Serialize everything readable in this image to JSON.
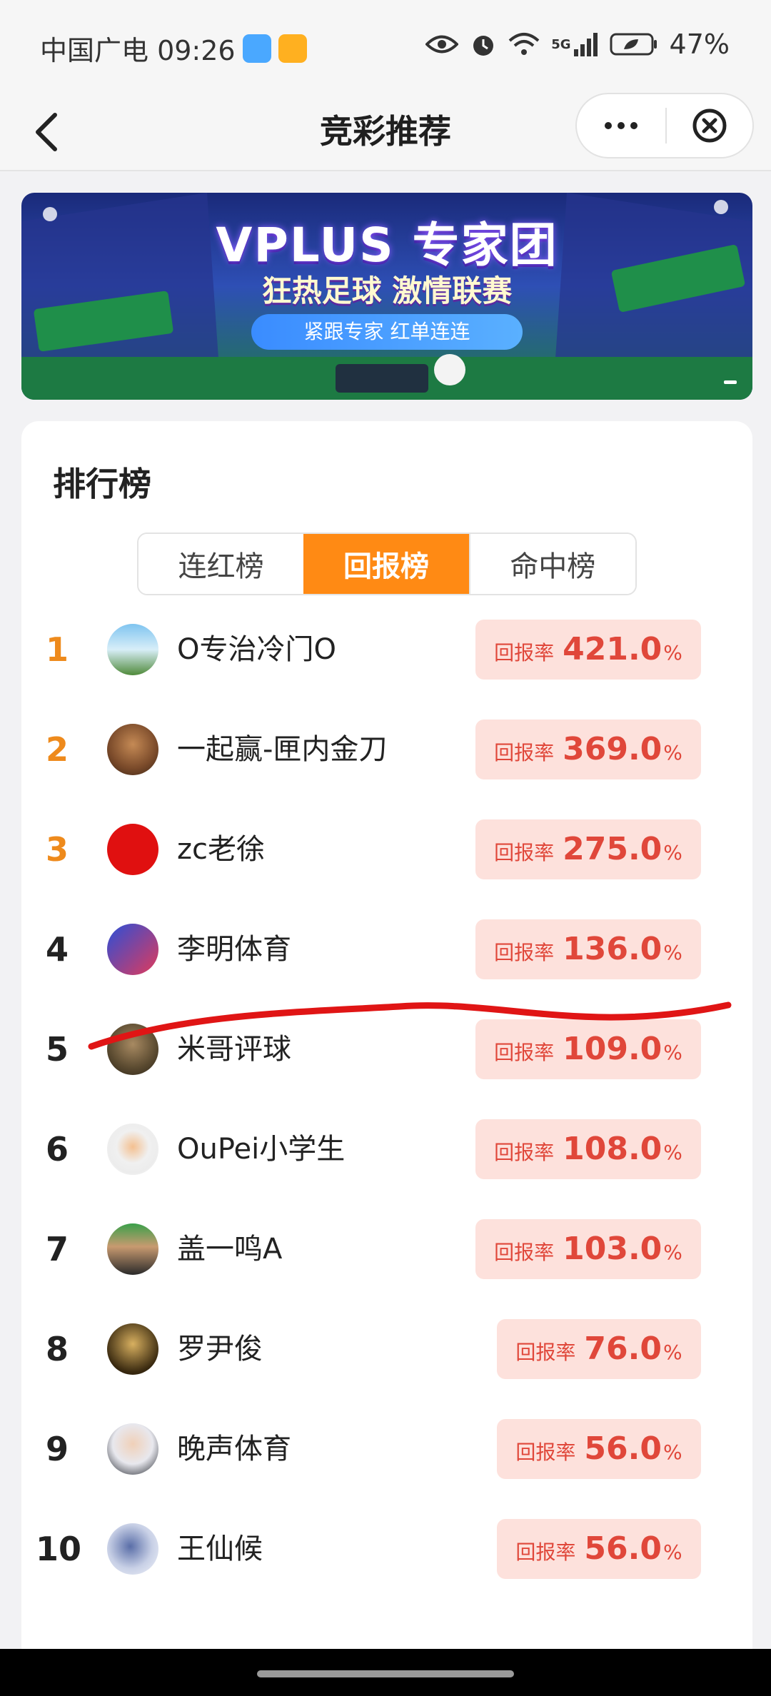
{
  "status_bar": {
    "carrier_time": "中国广电 09:26",
    "network": "5G",
    "battery": "47%",
    "icons": [
      "weather-icon",
      "weibo-icon",
      "eye-icon",
      "alarm-icon",
      "wifi-icon",
      "signal-icon",
      "battery-icon"
    ]
  },
  "header": {
    "title": "竞彩推荐",
    "icons": [
      "back-icon",
      "more-icon",
      "close-icon"
    ]
  },
  "banner": {
    "title": "VPLUS 专家团",
    "subtitle": "狂热足球 激情联赛",
    "tagline": "紧跟专家 红单连连"
  },
  "leaderboard": {
    "title": "排行榜",
    "tabs": [
      "连红榜",
      "回报榜",
      "命中榜"
    ],
    "active_tab": "回报榜",
    "colors": {
      "accent": "#ff8a14",
      "rate_text": "#e0473a",
      "rate_bg": "#fde1dc",
      "top_rank": "#ee8a1c"
    },
    "rows": [
      {
        "rank": "1",
        "name": "O专治冷门O",
        "label": "回报率",
        "value": "421.0",
        "unit": "%"
      },
      {
        "rank": "2",
        "name": "一起赢-匣内金刀",
        "label": "回报率",
        "value": "369.0",
        "unit": "%"
      },
      {
        "rank": "3",
        "name": "zc老徐",
        "label": "回报率",
        "value": "275.0",
        "unit": "%"
      },
      {
        "rank": "4",
        "name": "李明体育",
        "label": "回报率",
        "value": "136.0",
        "unit": "%"
      },
      {
        "rank": "5",
        "name": "米哥评球",
        "label": "回报率",
        "value": "109.0",
        "unit": "%"
      },
      {
        "rank": "6",
        "name": "OuPei小学生",
        "label": "回报率",
        "value": "108.0",
        "unit": "%"
      },
      {
        "rank": "7",
        "name": "盖一鸣A",
        "label": "回报率",
        "value": "103.0",
        "unit": "%"
      },
      {
        "rank": "8",
        "name": "罗尹俊",
        "label": "回报率",
        "value": "76.0",
        "unit": "%"
      },
      {
        "rank": "9",
        "name": "晚声体育",
        "label": "回报率",
        "value": "56.0",
        "unit": "%"
      },
      {
        "rank": "10",
        "name": "王仙候",
        "label": "回报率",
        "value": "56.0",
        "unit": "%"
      }
    ]
  }
}
